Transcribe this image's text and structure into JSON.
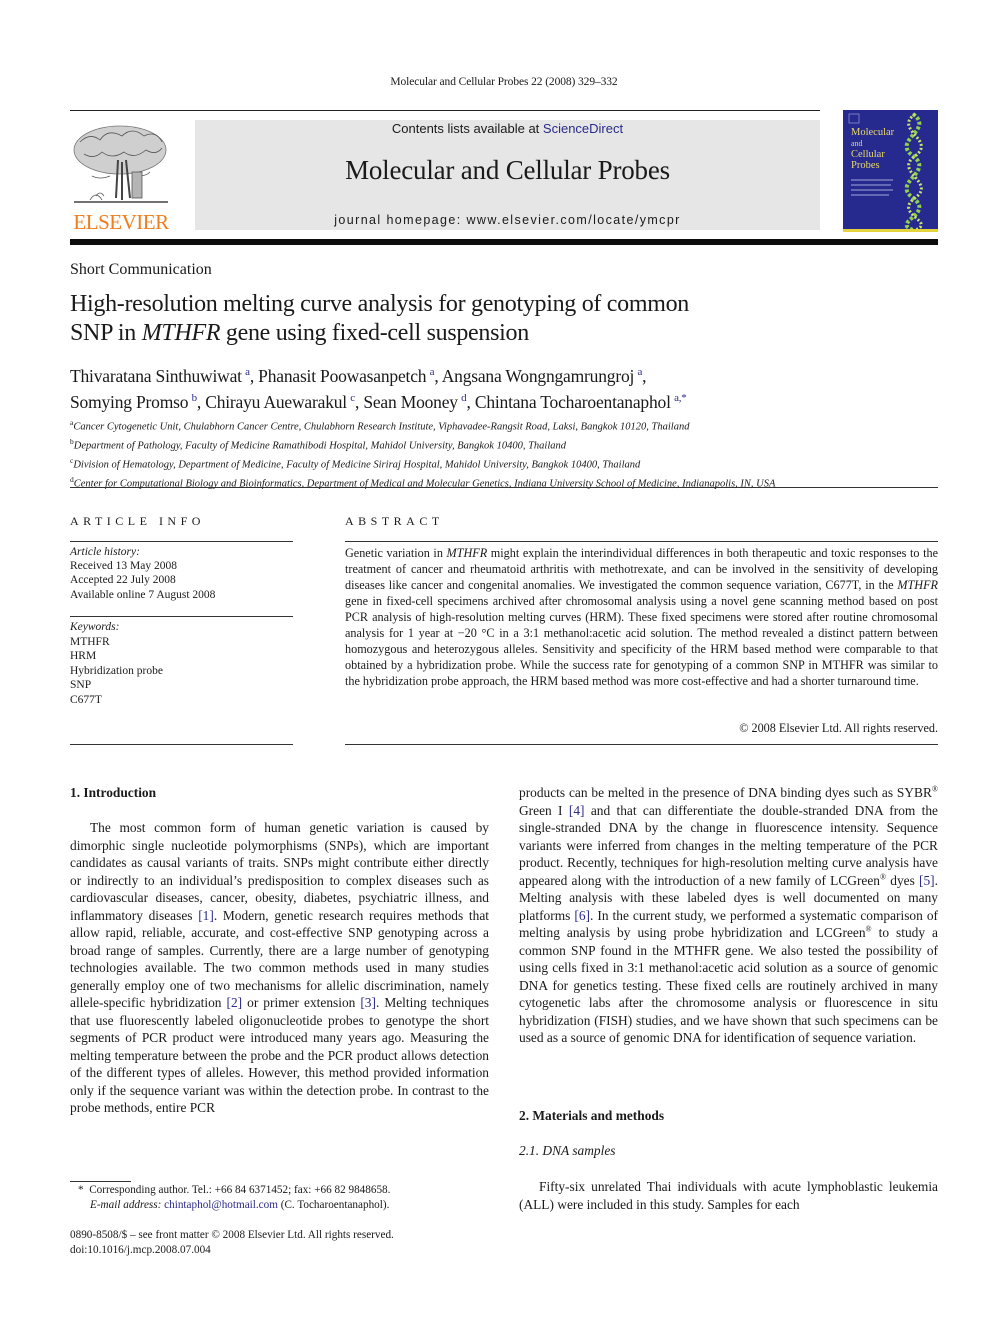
{
  "running_head": "Molecular and Cellular Probes 22 (2008) 329–332",
  "header": {
    "contents_prefix": "Contents lists available at ",
    "contents_link": "ScienceDirect",
    "journal_name": "Molecular and Cellular Probes",
    "homepage_label": "journal homepage: ",
    "homepage_url": "www.elsevier.com/locate/ymcpr",
    "publisher_logo_text": "ELSEVIER",
    "cover_title_lines": [
      "Molecular",
      "and",
      "Cellular",
      "Probes"
    ],
    "colors": {
      "publisher_orange": "#f07d1c",
      "cover_blue": "#262a8e",
      "cover_yellow": "#e5d33d",
      "banner_gray": "#e6e6e6",
      "link_blue": "#2a2a8a"
    }
  },
  "article": {
    "type": "Short Communication",
    "title_line1": "High-resolution melting curve analysis for genotyping of common",
    "title_line2_pre": "SNP in ",
    "title_line2_ital": "MTHFR",
    "title_line2_post": " gene using fixed-cell suspension",
    "authors": [
      {
        "name": "Thivaratana Sinthuwiwat",
        "aff": "a",
        "sep": ", "
      },
      {
        "name": "Phanasit Poowasanpetch",
        "aff": "a",
        "sep": ", "
      },
      {
        "name": "Angsana Wongngamrungroj",
        "aff": "a",
        "sep": ","
      },
      {
        "name": "Somying Promso",
        "aff": "b",
        "sep": ", "
      },
      {
        "name": "Chirayu Auewarakul",
        "aff": "c",
        "sep": ", "
      },
      {
        "name": "Sean Mooney",
        "aff": "d",
        "sep": ", "
      },
      {
        "name": "Chintana Tocharoentanaphol",
        "aff": "a,*",
        "sep": ""
      }
    ],
    "affiliations": [
      {
        "mark": "a",
        "text": "Cancer Cytogenetic Unit, Chulabhorn Cancer Centre, Chulabhorn Research Institute, Viphavadee-Rangsit Road, Laksi, Bangkok 10120, Thailand"
      },
      {
        "mark": "b",
        "text": "Department of Pathology, Faculty of Medicine Ramathibodi Hospital, Mahidol University, Bangkok 10400, Thailand"
      },
      {
        "mark": "c",
        "text": "Division of Hematology, Department of Medicine, Faculty of Medicine Siriraj Hospital, Mahidol University, Bangkok 10400, Thailand"
      },
      {
        "mark": "d",
        "text": "Center for Computational Biology and Bioinformatics, Department of Medical and Molecular Genetics, Indiana University School of Medicine, Indianapolis, IN, USA"
      }
    ]
  },
  "article_info": {
    "heading": "ARTICLE INFO",
    "history_label": "Article history:",
    "history": [
      "Received 13 May 2008",
      "Accepted 22 July 2008",
      "Available online 7 August 2008"
    ],
    "keywords_label": "Keywords:",
    "keywords": [
      "MTHFR",
      "HRM",
      "Hybridization probe",
      "SNP",
      "C677T"
    ]
  },
  "abstract": {
    "heading": "ABSTRACT",
    "segments": [
      {
        "t": "Genetic variation in "
      },
      {
        "t": "MTHFR",
        "i": true
      },
      {
        "t": " might explain the interindividual differences in both therapeutic and toxic responses to the treatment of cancer and rheumatoid arthritis with methotrexate, and can be involved in the sensitivity of developing diseases like cancer and congenital anomalies. We investigated the common sequence variation, C677T, in the "
      },
      {
        "t": "MTHFR",
        "i": true
      },
      {
        "t": " gene in fixed-cell specimens archived after chromosomal analysis using a novel gene scanning method based on post PCR analysis of high-resolution melting curves (HRM). These fixed specimens were stored after routine chromosomal analysis for 1 year at −20 °C in a 3:1 methanol:acetic acid solution. The method revealed a distinct pattern between homozygous and heterozygous alleles. Sensitivity and specificity of the HRM based method were comparable to that obtained by a hybridization probe. While the success rate for genotyping of a common SNP in MTHFR was similar to the hybridization probe approach, the HRM based method was more cost-effective and had a shorter turnaround time."
      }
    ],
    "copyright": "© 2008 Elsevier Ltd. All rights reserved."
  },
  "body": {
    "intro_heading": "1.  Introduction",
    "intro_segments": [
      {
        "t": "The most common form of human genetic variation is caused by dimorphic single nucleotide polymorphisms (SNPs), which are important candidates as causal variants of traits. SNPs might contribute either directly or indirectly to an individual’s predisposition to complex diseases such as cardiovascular diseases, cancer, obesity, diabetes, psychiatric illness, and inflammatory diseases "
      },
      {
        "t": "[1]",
        "link": true
      },
      {
        "t": ". Modern, genetic research requires methods that allow rapid, reliable, accurate, and cost-effective SNP genotyping across a broad range of samples. Currently, there are a large number of genotyping technologies available. The two common methods used in many studies generally employ one of two mechanisms for allelic discrimination, namely allele-specific hybridization "
      },
      {
        "t": "[2]",
        "link": true
      },
      {
        "t": " or primer extension "
      },
      {
        "t": "[3]",
        "link": true
      },
      {
        "t": ". Melting techniques that use fluorescently labeled oligonucleotide probes to genotype the short segments of PCR product were introduced many years ago. Measuring the melting temperature between the probe and the PCR product allows detection of the different types of alleles. However, this method provided information only if the sequence variant was within the detection probe. In contrast to the probe methods, entire PCR"
      }
    ],
    "right_segments": [
      {
        "t": "products can be melted in the presence of DNA binding dyes such as SYBR"
      },
      {
        "t": "®",
        "sup": true
      },
      {
        "t": " Green I "
      },
      {
        "t": "[4]",
        "link": true
      },
      {
        "t": " and that can differentiate the double-stranded DNA from the single-stranded DNA by the change in fluorescence intensity. Sequence variants were inferred from changes in the melting temperature of the PCR product. Recently, techniques for high-resolution melting curve analysis have appeared along with the introduction of a new family of LCGreen"
      },
      {
        "t": "®",
        "sup": true
      },
      {
        "t": " dyes "
      },
      {
        "t": "[5]",
        "link": true
      },
      {
        "t": ". Melting analysis with these labeled dyes is well documented on many platforms "
      },
      {
        "t": "[6]",
        "link": true
      },
      {
        "t": ". In the current study, we performed a systematic comparison of melting analysis by using probe hybridization and LCGreen"
      },
      {
        "t": "®",
        "sup": true
      },
      {
        "t": " to study a common SNP found in the MTHFR gene. We also tested the possibility of using cells fixed in 3:1 methanol:acetic acid solution as a source of genomic DNA for genetics testing. These fixed cells are routinely archived in many cytogenetic labs after the chromosome analysis or fluorescence in situ hybridization (FISH) studies, and we have shown that such specimens can be used as a source of genomic DNA for identification of sequence variation."
      }
    ],
    "methods_heading": "2.  Materials and methods",
    "dna_heading": "2.1.  DNA samples",
    "dna_text": "Fifty-six unrelated Thai individuals with acute lymphoblastic leukemia (ALL) were included in this study. Samples for each"
  },
  "footnote": {
    "mark": "*",
    "line1": "Corresponding author. Tel.: +66 84 6371452; fax: +66 82 9848658.",
    "email_label": "E-mail address: ",
    "email": "chintaphol@hotmail.com",
    "email_suffix": " (C. Tocharoentanaphol)."
  },
  "front_matter": {
    "line1": "0890-8508/$ – see front matter © 2008 Elsevier Ltd. All rights reserved.",
    "doi": "doi:10.1016/j.mcp.2008.07.004"
  }
}
